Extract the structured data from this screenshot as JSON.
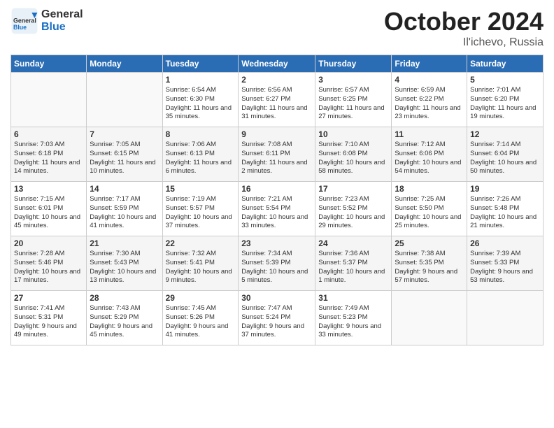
{
  "header": {
    "logo_general": "General",
    "logo_blue": "Blue",
    "title": "October 2024",
    "location": "Il'ichevo, Russia"
  },
  "columns": [
    "Sunday",
    "Monday",
    "Tuesday",
    "Wednesday",
    "Thursday",
    "Friday",
    "Saturday"
  ],
  "weeks": [
    [
      {
        "day": "",
        "info": ""
      },
      {
        "day": "",
        "info": ""
      },
      {
        "day": "1",
        "info": "Sunrise: 6:54 AM\nSunset: 6:30 PM\nDaylight: 11 hours and 35 minutes."
      },
      {
        "day": "2",
        "info": "Sunrise: 6:56 AM\nSunset: 6:27 PM\nDaylight: 11 hours and 31 minutes."
      },
      {
        "day": "3",
        "info": "Sunrise: 6:57 AM\nSunset: 6:25 PM\nDaylight: 11 hours and 27 minutes."
      },
      {
        "day": "4",
        "info": "Sunrise: 6:59 AM\nSunset: 6:22 PM\nDaylight: 11 hours and 23 minutes."
      },
      {
        "day": "5",
        "info": "Sunrise: 7:01 AM\nSunset: 6:20 PM\nDaylight: 11 hours and 19 minutes."
      }
    ],
    [
      {
        "day": "6",
        "info": "Sunrise: 7:03 AM\nSunset: 6:18 PM\nDaylight: 11 hours and 14 minutes."
      },
      {
        "day": "7",
        "info": "Sunrise: 7:05 AM\nSunset: 6:15 PM\nDaylight: 11 hours and 10 minutes."
      },
      {
        "day": "8",
        "info": "Sunrise: 7:06 AM\nSunset: 6:13 PM\nDaylight: 11 hours and 6 minutes."
      },
      {
        "day": "9",
        "info": "Sunrise: 7:08 AM\nSunset: 6:11 PM\nDaylight: 11 hours and 2 minutes."
      },
      {
        "day": "10",
        "info": "Sunrise: 7:10 AM\nSunset: 6:08 PM\nDaylight: 10 hours and 58 minutes."
      },
      {
        "day": "11",
        "info": "Sunrise: 7:12 AM\nSunset: 6:06 PM\nDaylight: 10 hours and 54 minutes."
      },
      {
        "day": "12",
        "info": "Sunrise: 7:14 AM\nSunset: 6:04 PM\nDaylight: 10 hours and 50 minutes."
      }
    ],
    [
      {
        "day": "13",
        "info": "Sunrise: 7:15 AM\nSunset: 6:01 PM\nDaylight: 10 hours and 45 minutes."
      },
      {
        "day": "14",
        "info": "Sunrise: 7:17 AM\nSunset: 5:59 PM\nDaylight: 10 hours and 41 minutes."
      },
      {
        "day": "15",
        "info": "Sunrise: 7:19 AM\nSunset: 5:57 PM\nDaylight: 10 hours and 37 minutes."
      },
      {
        "day": "16",
        "info": "Sunrise: 7:21 AM\nSunset: 5:54 PM\nDaylight: 10 hours and 33 minutes."
      },
      {
        "day": "17",
        "info": "Sunrise: 7:23 AM\nSunset: 5:52 PM\nDaylight: 10 hours and 29 minutes."
      },
      {
        "day": "18",
        "info": "Sunrise: 7:25 AM\nSunset: 5:50 PM\nDaylight: 10 hours and 25 minutes."
      },
      {
        "day": "19",
        "info": "Sunrise: 7:26 AM\nSunset: 5:48 PM\nDaylight: 10 hours and 21 minutes."
      }
    ],
    [
      {
        "day": "20",
        "info": "Sunrise: 7:28 AM\nSunset: 5:46 PM\nDaylight: 10 hours and 17 minutes."
      },
      {
        "day": "21",
        "info": "Sunrise: 7:30 AM\nSunset: 5:43 PM\nDaylight: 10 hours and 13 minutes."
      },
      {
        "day": "22",
        "info": "Sunrise: 7:32 AM\nSunset: 5:41 PM\nDaylight: 10 hours and 9 minutes."
      },
      {
        "day": "23",
        "info": "Sunrise: 7:34 AM\nSunset: 5:39 PM\nDaylight: 10 hours and 5 minutes."
      },
      {
        "day": "24",
        "info": "Sunrise: 7:36 AM\nSunset: 5:37 PM\nDaylight: 10 hours and 1 minute."
      },
      {
        "day": "25",
        "info": "Sunrise: 7:38 AM\nSunset: 5:35 PM\nDaylight: 9 hours and 57 minutes."
      },
      {
        "day": "26",
        "info": "Sunrise: 7:39 AM\nSunset: 5:33 PM\nDaylight: 9 hours and 53 minutes."
      }
    ],
    [
      {
        "day": "27",
        "info": "Sunrise: 7:41 AM\nSunset: 5:31 PM\nDaylight: 9 hours and 49 minutes."
      },
      {
        "day": "28",
        "info": "Sunrise: 7:43 AM\nSunset: 5:29 PM\nDaylight: 9 hours and 45 minutes."
      },
      {
        "day": "29",
        "info": "Sunrise: 7:45 AM\nSunset: 5:26 PM\nDaylight: 9 hours and 41 minutes."
      },
      {
        "day": "30",
        "info": "Sunrise: 7:47 AM\nSunset: 5:24 PM\nDaylight: 9 hours and 37 minutes."
      },
      {
        "day": "31",
        "info": "Sunrise: 7:49 AM\nSunset: 5:23 PM\nDaylight: 9 hours and 33 minutes."
      },
      {
        "day": "",
        "info": ""
      },
      {
        "day": "",
        "info": ""
      }
    ]
  ]
}
